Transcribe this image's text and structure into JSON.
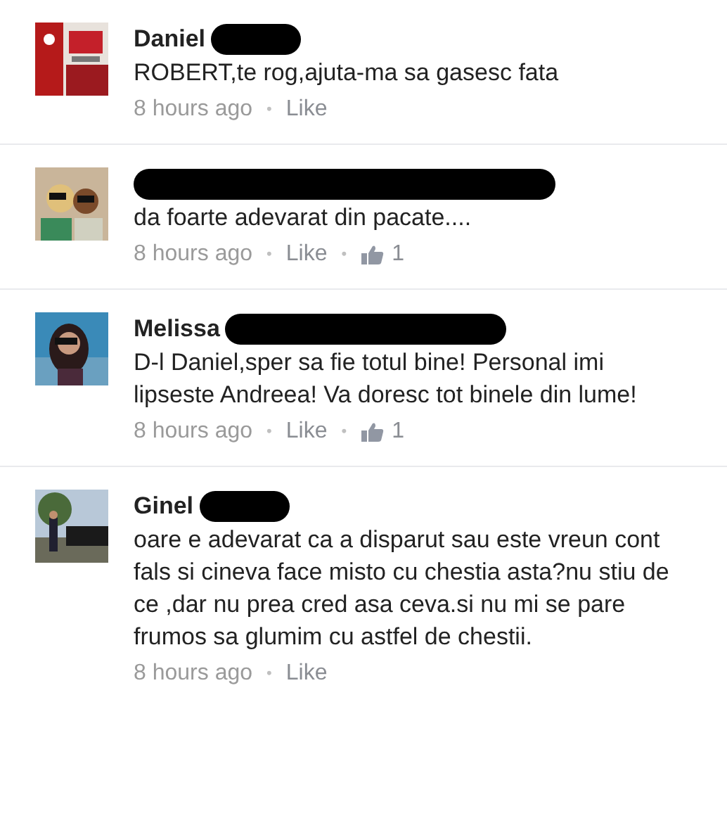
{
  "comments": [
    {
      "name": "Daniel",
      "text": "ROBERT,te rog,ajuta-ma sa gasesc fata",
      "time": "8 hours ago",
      "separator": "•",
      "like": "Like"
    },
    {
      "text": "da foarte adevarat din pacate....",
      "time": "8 hours ago",
      "separator": "•",
      "like": "Like",
      "likes": "1"
    },
    {
      "name": "Melissa",
      "text": "D-l Daniel,sper sa fie totul bine! Personal imi lipseste Andreea! Va doresc tot binele din lume!",
      "time": "8 hours ago",
      "separator": "•",
      "like": "Like",
      "likes": "1"
    },
    {
      "name": "Ginel",
      "text": "oare e adevarat ca a disparut sau este vreun cont fals si cineva face misto cu chestia asta?nu stiu de ce ,dar nu prea cred asa ceva.si nu mi se pare frumos sa glumim cu astfel de chestii.",
      "time": "8 hours ago",
      "separator": "•",
      "like": "Like"
    }
  ]
}
